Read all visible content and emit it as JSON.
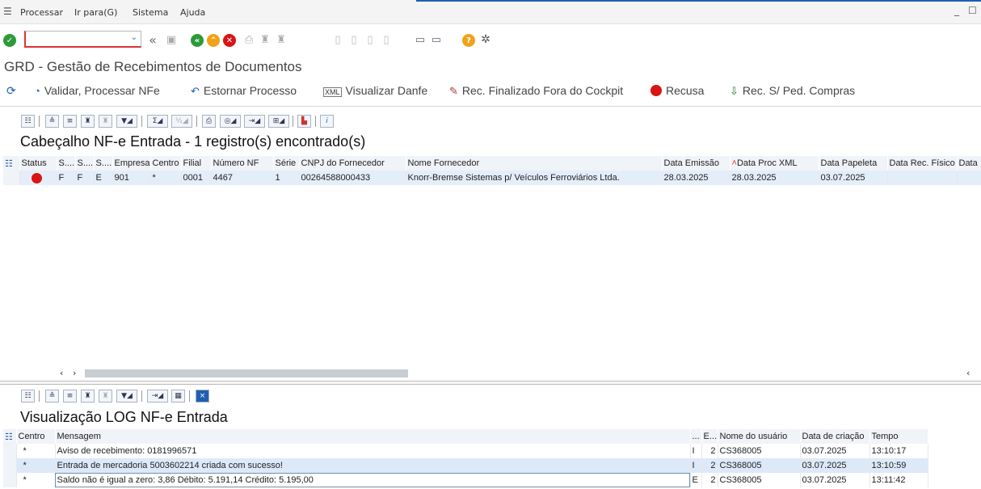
{
  "menu": {
    "items": [
      "Processar",
      "Ir para(G)",
      "Sistema",
      "Ajuda"
    ],
    "window_controls": [
      "_",
      "☐"
    ]
  },
  "command_field": {
    "value": "",
    "placeholder": ""
  },
  "page_title": "GRD - Gestão de Recebimentos de Documentos",
  "actions": [
    {
      "label": "Validar, Processar NFe",
      "icon": "clock-arrow-icon"
    },
    {
      "label": "Estornar Processo",
      "icon": "undo-arrow-icon"
    },
    {
      "label": "Visualizar Danfe",
      "icon": "xml-document-icon"
    },
    {
      "label": "Rec. Finalizado Fora do Cockpit",
      "icon": "pencil-icon"
    },
    {
      "label": "Recusa",
      "icon": "stop-sign-icon"
    },
    {
      "label": "Rec. S/ Ped. Compras",
      "icon": "inbox-tray-icon"
    }
  ],
  "header_section": {
    "title": "Cabeçalho NF-e Entrada - 1 registro(s) encontrado(s)",
    "columns": [
      "Status",
      "S....",
      "S....",
      "S....",
      "Empresa",
      "Centro",
      "Filial",
      "Número NF",
      "Série",
      "CNPJ do Fornecedor",
      "Nome Fornecedor",
      "Data Emissão",
      "Data Proc XML",
      "Data Papeleta",
      "Data Rec. Físico",
      "Data"
    ],
    "rows": [
      {
        "status": "red",
        "s1": "F",
        "s2": "F",
        "s3": "E",
        "empresa": "901",
        "centro": "*",
        "filial": "0001",
        "numero_nf": "4467",
        "serie": "1",
        "cnpj": "00264588000433",
        "fornecedor": "Knorr-Bremse Sistemas p/ Veículos Ferroviários Ltda.",
        "data_emissao": "28.03.2025",
        "data_proc_xml": "28.03.2025",
        "data_papeleta": "03.07.2025",
        "data_rec_fisico": "",
        "data": ""
      }
    ]
  },
  "log_section": {
    "title": "Visualização LOG NF-e Entrada",
    "columns": [
      "Centro",
      "Mensagem",
      "...",
      "E...",
      "Nome do usuário",
      "Data de criação",
      "Tempo"
    ],
    "rows": [
      {
        "centro": "*",
        "mensagem": "Aviso de recebimento:  0181996571",
        "tipo": "I",
        "e": "2",
        "usuario": "CS368005",
        "data": "03.07.2025",
        "tempo": "13:10:17"
      },
      {
        "centro": "*",
        "mensagem": "Entrada de mercadoria 5003602214 criada com sucesso!",
        "tipo": "I",
        "e": "2",
        "usuario": "CS368005",
        "data": "03.07.2025",
        "tempo": "13:10:59"
      },
      {
        "centro": "*",
        "mensagem": "Saldo não é igual a zero: 3,86  Débito: 5.191,14  Crédito: 5.195,00",
        "tipo": "E",
        "e": "2",
        "usuario": "CS368005",
        "data": "03.07.2025",
        "tempo": "13:11:42"
      }
    ]
  },
  "colors": {
    "accent_blue": "#1f5fb0",
    "green": "#2e9a3a",
    "orange": "#f0a21a",
    "red": "#d91414"
  }
}
